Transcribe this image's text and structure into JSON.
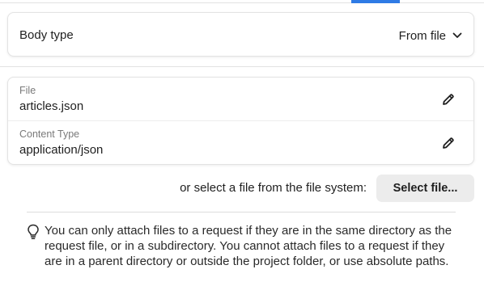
{
  "body_type": {
    "label": "Body type",
    "value": "From file"
  },
  "file_details": {
    "file": {
      "label": "File",
      "value": "articles.json"
    },
    "content_type": {
      "label": "Content Type",
      "value": "application/json"
    }
  },
  "file_picker": {
    "prompt": "or select a file from the file system:",
    "button_label": "Select file..."
  },
  "info": {
    "icon": "lightbulb-icon",
    "text": "You can only attach files to a request if they are in the same directory as the request file, or in a subdirectory. You cannot attach files to a request if they are in a parent directory or outside the project folder, or use absolute paths."
  },
  "colors": {
    "accent": "#2f7be5",
    "button_bg": "#ececec",
    "muted_text": "#7a7a7a"
  }
}
